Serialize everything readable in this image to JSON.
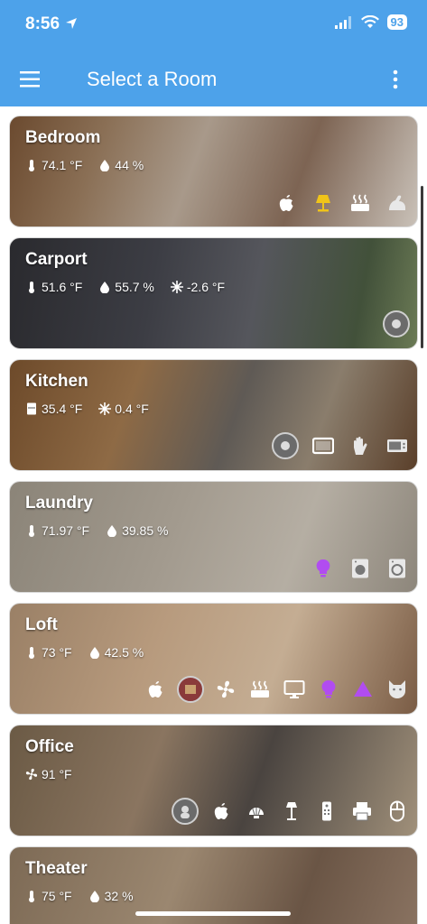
{
  "status_bar": {
    "time": "8:56",
    "battery": "93"
  },
  "app_bar": {
    "title": "Select a Room"
  },
  "rooms": [
    {
      "name": "Bedroom",
      "readings": [
        {
          "icon": "thermometer-icon",
          "value": "74.1 °F"
        },
        {
          "icon": "humidity-icon",
          "value": "44 %"
        }
      ]
    },
    {
      "name": "Carport",
      "readings": [
        {
          "icon": "thermometer-icon",
          "value": "51.6 °F"
        },
        {
          "icon": "humidity-icon",
          "value": "55.7 %"
        },
        {
          "icon": "snowflake-icon",
          "value": "-2.6 °F"
        }
      ]
    },
    {
      "name": "Kitchen",
      "readings": [
        {
          "icon": "fridge-icon",
          "value": "35.4 °F"
        },
        {
          "icon": "snowflake-icon",
          "value": "0.4 °F"
        }
      ]
    },
    {
      "name": "Laundry",
      "readings": [
        {
          "icon": "thermometer-icon",
          "value": "71.97 °F"
        },
        {
          "icon": "humidity-icon",
          "value": "39.85 %"
        }
      ]
    },
    {
      "name": "Loft",
      "readings": [
        {
          "icon": "thermometer-icon",
          "value": "73 °F"
        },
        {
          "icon": "humidity-icon",
          "value": "42.5 %"
        }
      ]
    },
    {
      "name": "Office",
      "readings": [
        {
          "icon": "fan-ac-icon",
          "value": "91 °F"
        }
      ]
    },
    {
      "name": "Theater",
      "readings": [
        {
          "icon": "thermometer-icon",
          "value": "75 °F"
        },
        {
          "icon": "humidity-icon",
          "value": "32 %"
        }
      ]
    }
  ],
  "colors": {
    "app_bar": "#4da2ea",
    "accent_light": "#f0c419",
    "accent_purple": "#b14cf0",
    "icon_white": "#ffffff"
  }
}
